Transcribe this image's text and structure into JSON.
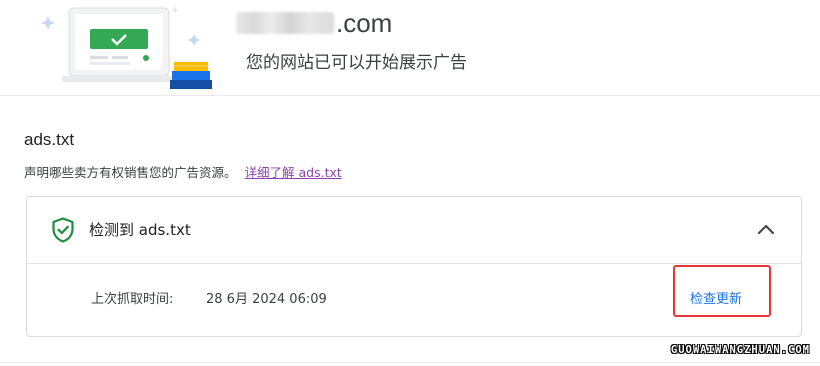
{
  "site": {
    "domain_suffix": ".com",
    "status": "您的网站已可以开始展示广告"
  },
  "ads_txt": {
    "title": "ads.txt",
    "description": "声明哪些卖方有权销售您的广告资源。",
    "learn_more_link": "详细了解 ads.txt"
  },
  "status_card": {
    "status_icon": "shield-check-icon",
    "status_title": "检测到 ads.txt",
    "collapse_icon": "chevron-up-icon",
    "last_crawled_label": "上次抓取时间:",
    "last_crawled_value": "28 6月 2024 06:09",
    "check_update_button": "检查更新"
  },
  "colors": {
    "success_green": "#1e8e3e",
    "link_blue": "#1a73e8",
    "link_visited": "#8e44ad",
    "highlight_red": "#e53935"
  },
  "watermark": "GUOWAIWANGZHUAN.COM"
}
